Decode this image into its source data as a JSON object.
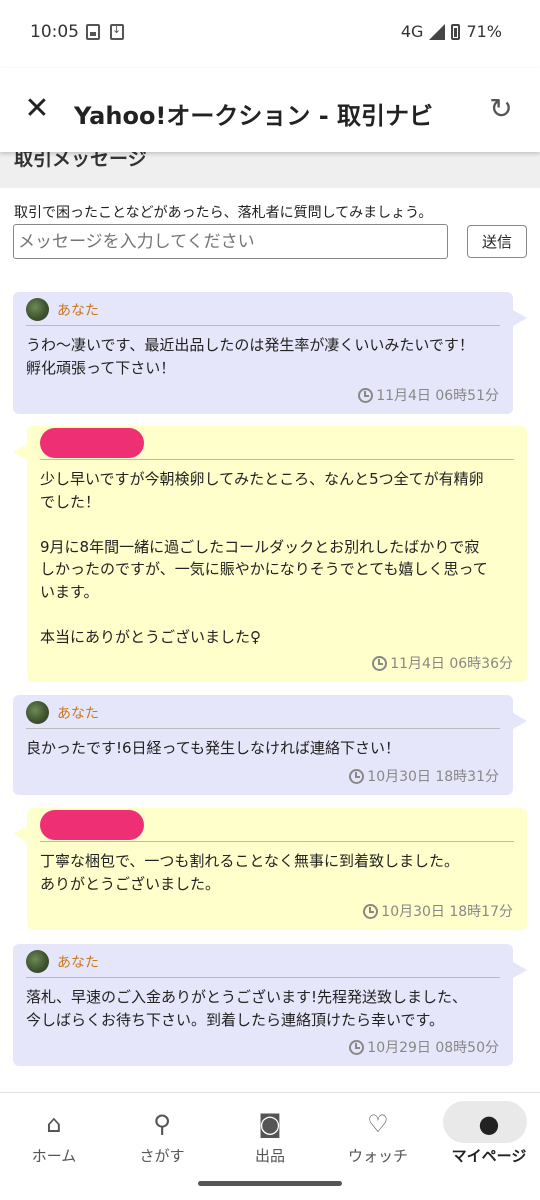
{
  "status": {
    "time": "10:05",
    "network": "4G",
    "battery": "71%"
  },
  "appbar": {
    "title": "Yahoo!オークション - 取引ナビ",
    "close_icon": "close-icon",
    "reload_icon": "reload-icon"
  },
  "section": {
    "title": "取引メッセージ",
    "intro": "取引で困ったことなどがあったら、落札者に質問してみましょう。",
    "input_placeholder": "メッセージを入力してください",
    "send_label": "送信"
  },
  "messages": [
    {
      "sender": "あなた",
      "type": "mine",
      "text": "うわ〜凄いです、最近出品したのは発生率が凄くいいみたいです！\n孵化頑張って下さい！",
      "time": "11月4日 06時51分"
    },
    {
      "sender": "",
      "type": "other",
      "text": "少し早いですが今朝検卵してみたところ、なんと5つ全てが有精卵\nでした！\n\n9月に8年間一緒に過ごしたコールダックとお別れしたばかりで寂\nしかったのですが、一気に賑やかになりそうでとても嬉しく思って\nいます。\n\n本当にありがとうございました♀",
      "time": "11月4日 06時36分"
    },
    {
      "sender": "あなた",
      "type": "mine",
      "text": "良かったです!6日経っても発生しなければ連絡下さい！",
      "time": "10月30日 18時31分"
    },
    {
      "sender": "",
      "type": "other",
      "text": "丁寧な梱包で、一つも割れることなく無事に到着致しました。\nありがとうございました。",
      "time": "10月30日 18時17分"
    },
    {
      "sender": "あなた",
      "type": "mine",
      "text": "落札、早速のご入金ありがとうございます!先程発送致しました、\n今しばらくお待ち下さい。到着したら連絡頂けたら幸いです。",
      "time": "10月29日 08時50分"
    }
  ],
  "bottom_nav": [
    {
      "label": "ホーム",
      "icon": "home-icon",
      "active": false
    },
    {
      "label": "さがす",
      "icon": "search-icon",
      "active": false
    },
    {
      "label": "出品",
      "icon": "camera-icon",
      "active": false
    },
    {
      "label": "ウォッチ",
      "icon": "heart-icon",
      "active": false
    },
    {
      "label": "マイページ",
      "icon": "person-icon",
      "active": true
    }
  ],
  "colors": {
    "mine_bubble": "#e6e6fa",
    "other_bubble": "#ffffcc",
    "sender_name": "#c8781e",
    "redaction": "#ee2f74"
  }
}
